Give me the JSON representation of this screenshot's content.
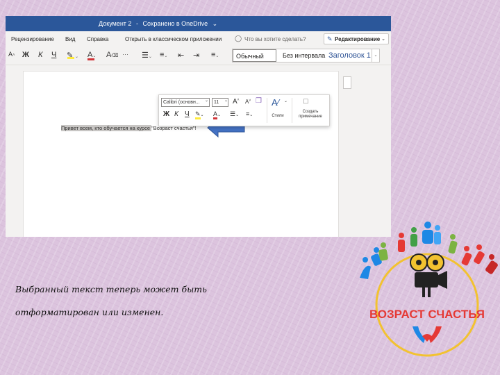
{
  "window": {
    "doc_name": "Документ 2",
    "separator": "-",
    "save_status": "Сохранено в OneDrive",
    "save_chevron": "⌄"
  },
  "menu": {
    "items": [
      "Рецензирование",
      "Вид",
      "Справка",
      "Открыть в классическом приложении"
    ],
    "tell_me_placeholder": "Что вы хотите сделать?",
    "edit_mode_label": "Редактирование",
    "edit_mode_chevron": "⌄"
  },
  "ribbon": {
    "font_size_icon": "A",
    "bold": "Ж",
    "italic": "К",
    "underline": "Ч",
    "font_color": "A",
    "clear_format": "A",
    "more": "···",
    "dropdown": "⌄",
    "styles": [
      "Обычный",
      "Без интервала",
      "Заголовок 1"
    ]
  },
  "mini_toolbar": {
    "font_name": "Calibri (основн...",
    "font_size": "11",
    "grow_font": "A",
    "shrink_font": "A",
    "bold": "Ж",
    "italic": "К",
    "underline": "Ч",
    "font_color": "A",
    "dropdown": "⌄",
    "styles_label": "Стили",
    "comment_label": "Создать примечание"
  },
  "document": {
    "selected_text": "Привет всем, кто обучается на курсе ",
    "tail_text": "\"Возраст счастья\"!"
  },
  "caption": {
    "line1": "Выбранный текст теперь может быть",
    "line2": "отформатирован или изменен."
  },
  "logo": {
    "text": "ВОЗРАСТ СЧАСТЬЯ"
  },
  "colors": {
    "title_bar": "#2b579a",
    "arrow": "#4472c4",
    "logo_text": "#e53935",
    "logo_ring": "#f2c230"
  }
}
